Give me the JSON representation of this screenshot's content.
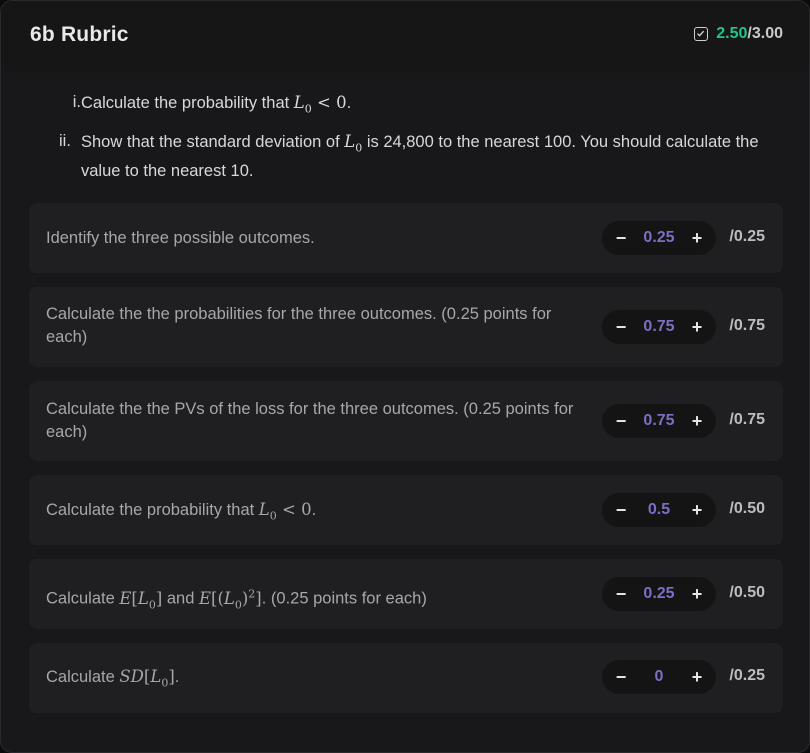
{
  "header": {
    "title": "6b Rubric",
    "score_got": "2.50",
    "score_total": "/3.00"
  },
  "questions": [
    {
      "num": "i.",
      "pre": "Calculate the probability that ",
      "math": "L0 < 0",
      "post": "."
    },
    {
      "num": "ii.",
      "pre": "Show that the standard deviation of ",
      "math": "L0",
      "post": " is 24,800 to the nearest 100. You should calculate the value to the nearest 10."
    }
  ],
  "rubric": [
    {
      "label": "Identify the three possible outcomes.",
      "value": "0.25",
      "max": "/0.25"
    },
    {
      "label": "Calculate the the probabilities for the three outcomes. (0.25 points for each)",
      "value": "0.75",
      "max": "/0.75"
    },
    {
      "label": "Calculate the the PVs of the loss for the three outcomes. (0.25 points for each)",
      "value": "0.75",
      "max": "/0.75"
    },
    {
      "label_pre": "Calculate the probability that ",
      "label_math": "L0 < 0",
      "label_post": ".",
      "value": "0.5",
      "max": "/0.50"
    },
    {
      "label_pre": "Calculate ",
      "label_math1": "E[L0]",
      "label_mid": " and ",
      "label_math2": "E[(L0)2]",
      "label_post": ". (0.25 points for each)",
      "value": "0.25",
      "max": "/0.50"
    },
    {
      "label_pre": "Calculate ",
      "label_math": "SD[L0]",
      "label_post": ".",
      "value": "0",
      "max": "/0.25"
    }
  ],
  "controls": {
    "minus": "−",
    "plus": "+"
  },
  "colors": {
    "accent_green": "#22c38e",
    "value_purple": "#7b6fc4"
  }
}
